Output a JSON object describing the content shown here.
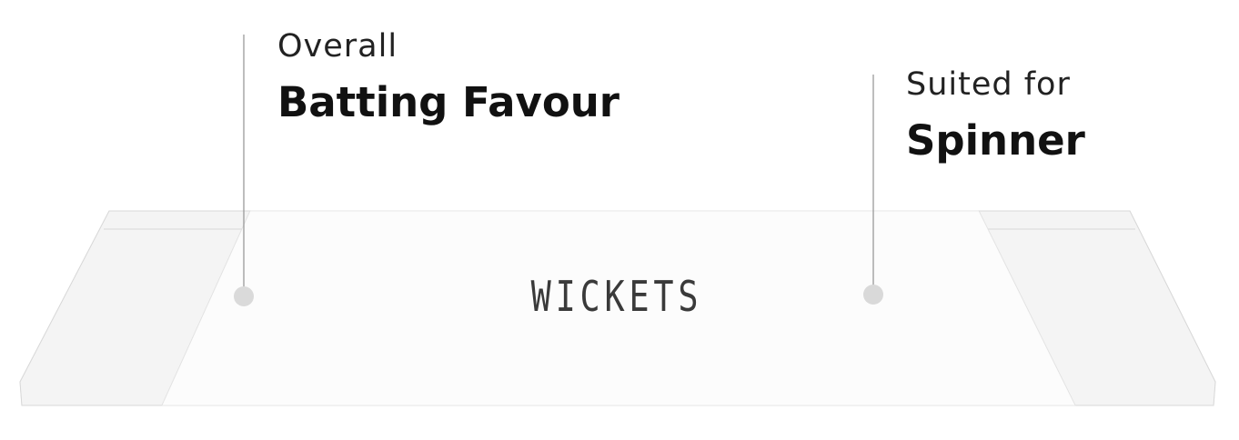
{
  "callouts": {
    "overall": {
      "small_label": "Overall",
      "big_label": "Batting Favour"
    },
    "suited": {
      "small_label": "Suited for",
      "big_label": "Spinner"
    }
  },
  "pitch": {
    "center_label": "WICKETS"
  },
  "colors": {
    "text": "#111111",
    "pitch_fill": "#fafafa",
    "pitch_edge": "#dcdcdc",
    "marker": "#d9d9d9"
  }
}
